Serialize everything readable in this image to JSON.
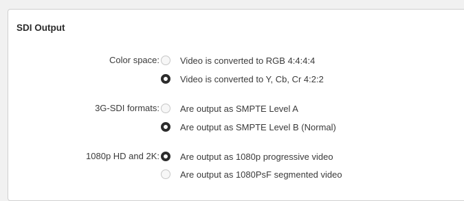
{
  "section": {
    "title": "SDI Output"
  },
  "groups": [
    {
      "label": "Color space:",
      "options": [
        {
          "label": "Video is converted to RGB 4:4:4:4",
          "selected": false
        },
        {
          "label": "Video is converted to Y, Cb, Cr 4:2:2",
          "selected": true
        }
      ]
    },
    {
      "label": "3G-SDI formats:",
      "options": [
        {
          "label": "Are output as SMPTE Level A",
          "selected": false
        },
        {
          "label": "Are output as SMPTE Level B (Normal)",
          "selected": true
        }
      ]
    },
    {
      "label": "1080p HD and 2K:",
      "options": [
        {
          "label": "Are output as 1080p progressive video",
          "selected": true
        },
        {
          "label": "Are output as 1080PsF segmented video",
          "selected": false
        }
      ]
    }
  ]
}
